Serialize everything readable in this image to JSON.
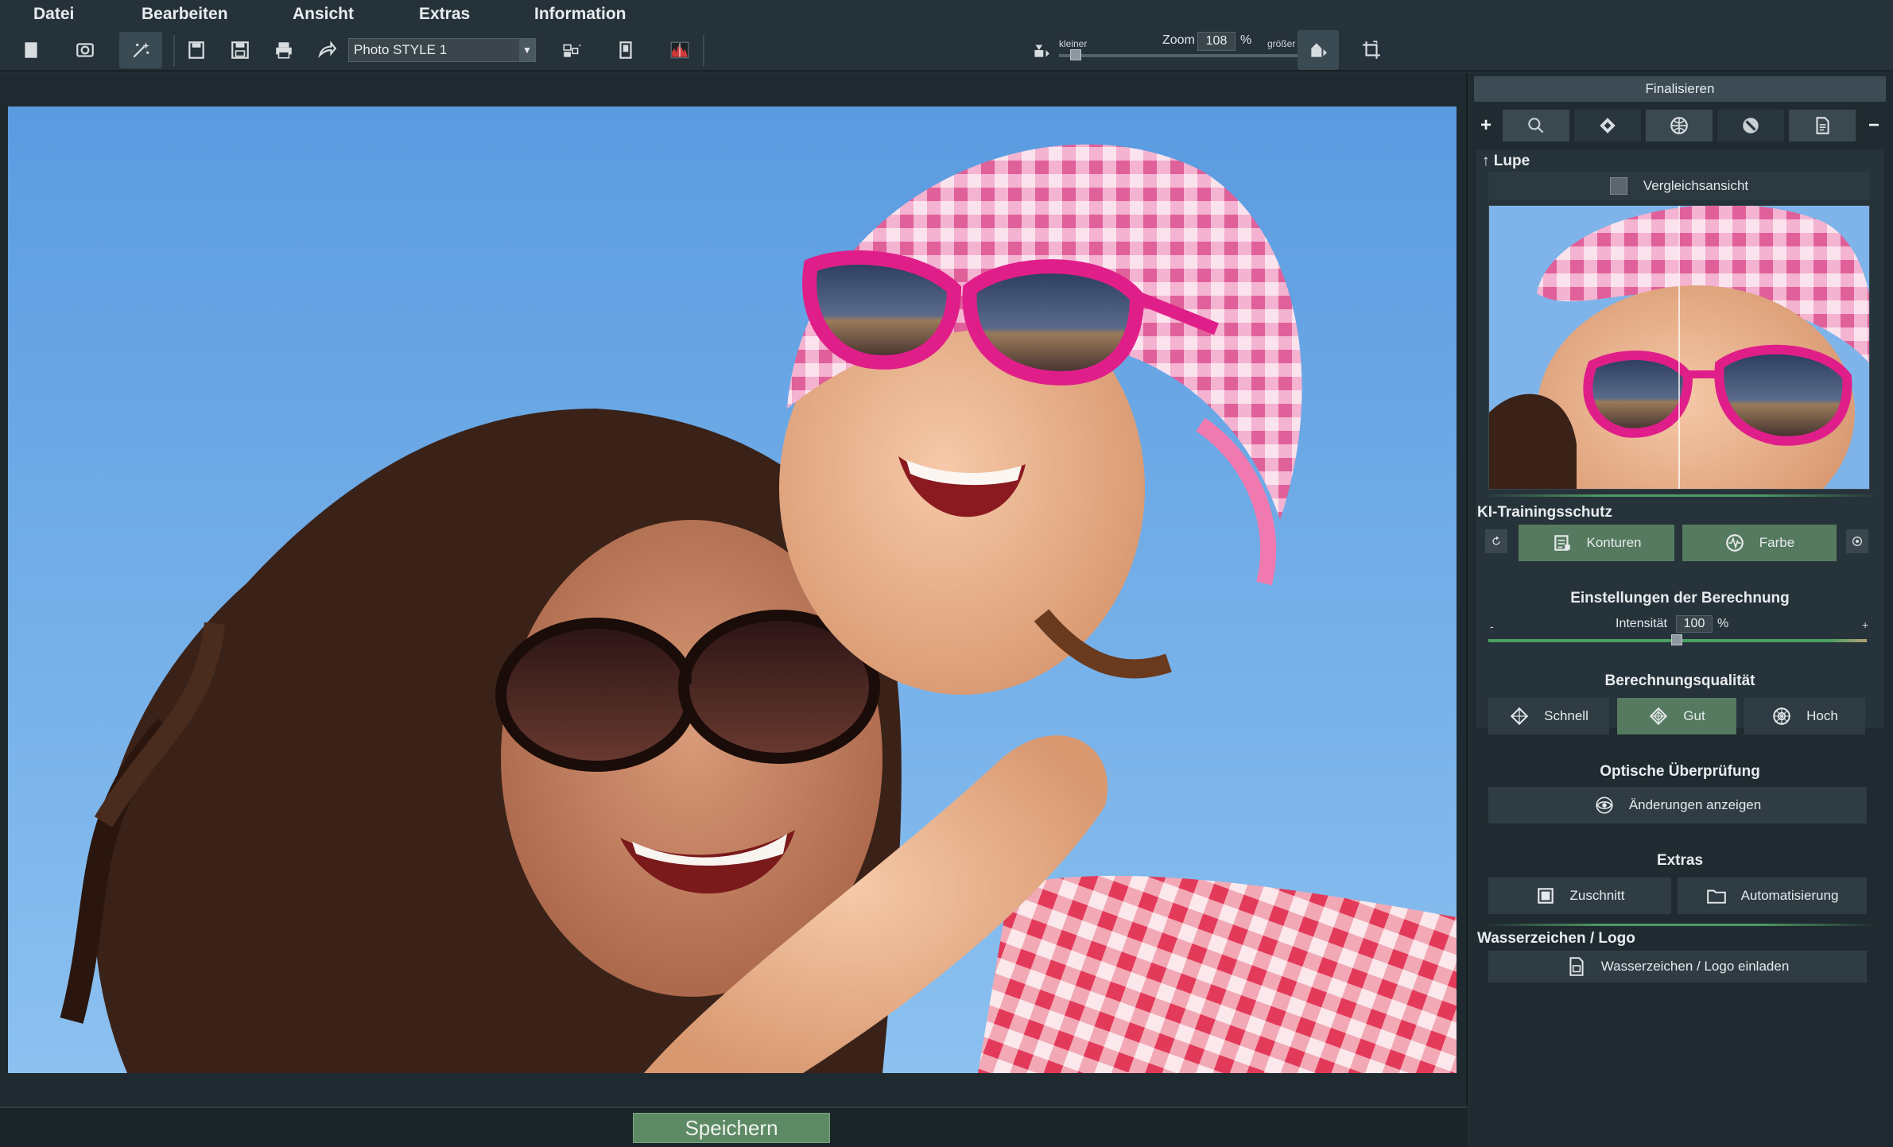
{
  "menu": {
    "items": [
      "Datei",
      "Bearbeiten",
      "Ansicht",
      "Extras",
      "Information"
    ]
  },
  "toolbar": {
    "style_select": "Photo STYLE 1",
    "zoom": {
      "small_label": "kleiner",
      "big_label": "größer",
      "label": "Zoom",
      "value": "108",
      "unit": "%"
    }
  },
  "footer": {
    "save_label": "Speichern"
  },
  "panel": {
    "title": "Finalisieren",
    "tab_plus": "+",
    "tab_minus": "−",
    "lupe": {
      "heading": "Lupe",
      "compare_label": "Vergleichsansicht"
    },
    "ki": {
      "heading": "KI-Trainingsschutz",
      "konturen_label": "Konturen",
      "farbe_label": "Farbe"
    },
    "berechnung": {
      "heading": "Einstellungen der Berechnung",
      "intensity_label": "Intensität",
      "intensity_value": "100",
      "intensity_unit": "%",
      "min_label": "-",
      "max_label": "+"
    },
    "qualitaet": {
      "heading": "Berechnungsqualität",
      "schnell_label": "Schnell",
      "gut_label": "Gut",
      "hoch_label": "Hoch"
    },
    "optisch": {
      "heading": "Optische Überprüfung",
      "show_changes_label": "Änderungen anzeigen"
    },
    "extras": {
      "heading": "Extras",
      "zuschnitt_label": "Zuschnitt",
      "automatisierung_label": "Automatisierung"
    },
    "wasserzeichen": {
      "heading": "Wasserzeichen / Logo",
      "load_label": "Wasserzeichen / Logo einladen"
    }
  },
  "colors": {
    "accent_green": "#557a5f",
    "save_green": "#5c8a64",
    "panel_bg": "#202b31"
  }
}
